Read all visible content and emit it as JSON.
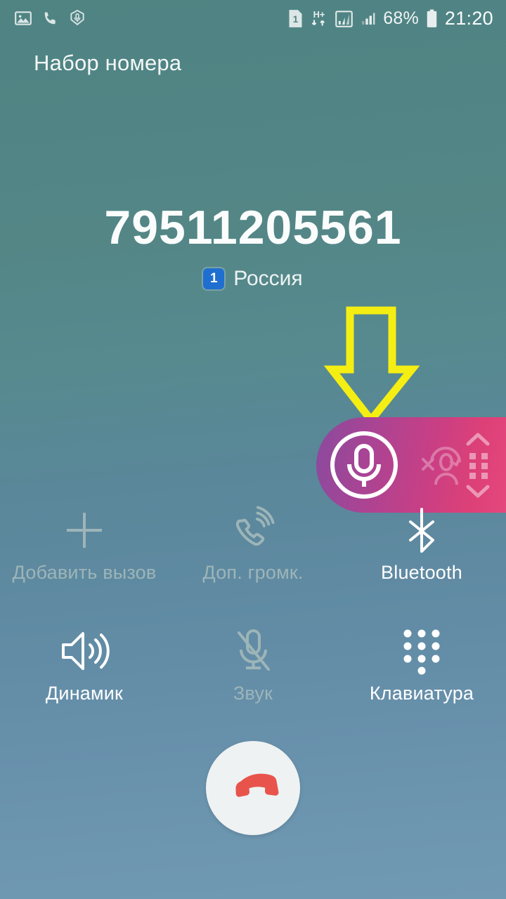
{
  "statusbar": {
    "left_icons": [
      {
        "name": "screenshot-image-icon",
        "label": "screenshot"
      },
      {
        "name": "missed-call-icon",
        "label": "call"
      },
      {
        "name": "voice-recorder-icon",
        "label": "recorder"
      }
    ],
    "sim_slot": "1",
    "network_type": "H+",
    "battery_percent": "68%",
    "time": "21:20"
  },
  "header": {
    "title": "Набор номера"
  },
  "call": {
    "number": "79511205561",
    "sim_badge": "1",
    "sim_label": "Россия"
  },
  "float_panel": {
    "accent_from": "#8a4a9e",
    "accent_to": "#e4487c",
    "mic_button_label": "mic-record-button",
    "transfer_label": "transfer-contact",
    "grip_label": "drag-handle"
  },
  "annotation": {
    "arrow_color": "#f5ee12",
    "points_to": "mic-record-button"
  },
  "options": [
    {
      "key": "add-call",
      "icon": "plus-icon",
      "label": "Добавить вызов",
      "state": "off"
    },
    {
      "key": "extra-vol",
      "icon": "call-volume-icon",
      "label": "Доп. громк.",
      "state": "off"
    },
    {
      "key": "bluetooth",
      "icon": "bluetooth-icon",
      "label": "Bluetooth",
      "state": "on"
    },
    {
      "key": "speaker",
      "icon": "speaker-icon",
      "label": "Динамик",
      "state": "on"
    },
    {
      "key": "mute",
      "icon": "mic-muted-icon",
      "label": "Звук",
      "state": "off"
    },
    {
      "key": "keypad",
      "icon": "dialpad-icon",
      "label": "Клавиатура",
      "state": "on"
    }
  ],
  "end_call": {
    "label": "end-call-button",
    "icon_color": "#e8544b",
    "background": "#eef2f2"
  }
}
